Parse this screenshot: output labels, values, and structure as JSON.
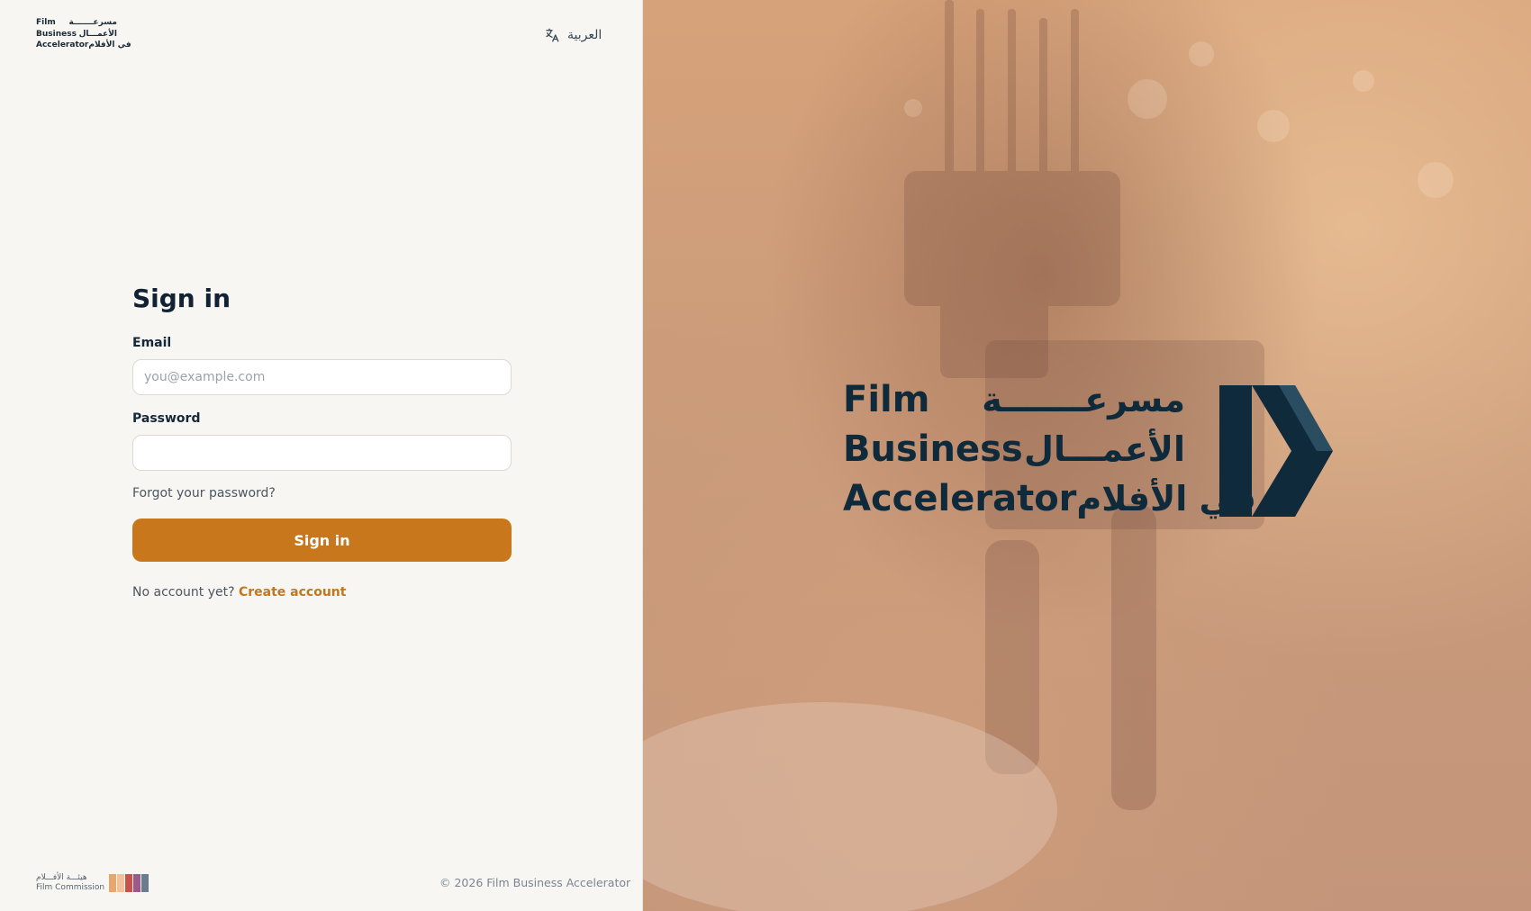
{
  "brand": {
    "name_en_lines": [
      "Film",
      "Business",
      "Accelerator"
    ],
    "name_ar_lines": [
      "مسرعـــــــة",
      "الأعمـــال",
      "في الأفلام"
    ]
  },
  "language_toggle": {
    "label": "العربية",
    "icon": "translate-icon"
  },
  "signin": {
    "title": "Sign in",
    "email_label": "Email",
    "email_placeholder": "you@example.com",
    "email_value": "",
    "password_label": "Password",
    "password_value": "",
    "forgot_link": "Forgot your password?",
    "submit_label": "Sign in",
    "no_account_text": "No account yet?",
    "create_account_link": "Create account"
  },
  "footer": {
    "partner_ar": "هيئـــة الأفـــلام",
    "partner_en": "Film Commission",
    "partner_colors": [
      "#e9a66a",
      "#f2c09a",
      "#c9534a",
      "#9b5a8a",
      "#6a7c8e"
    ],
    "copyright": "© 2026 Film Business Accelerator"
  },
  "colors": {
    "accent": "#c8771d",
    "link": "#c07820",
    "navy": "#0e2a3b",
    "panel_bg": "#f8f6f2"
  }
}
